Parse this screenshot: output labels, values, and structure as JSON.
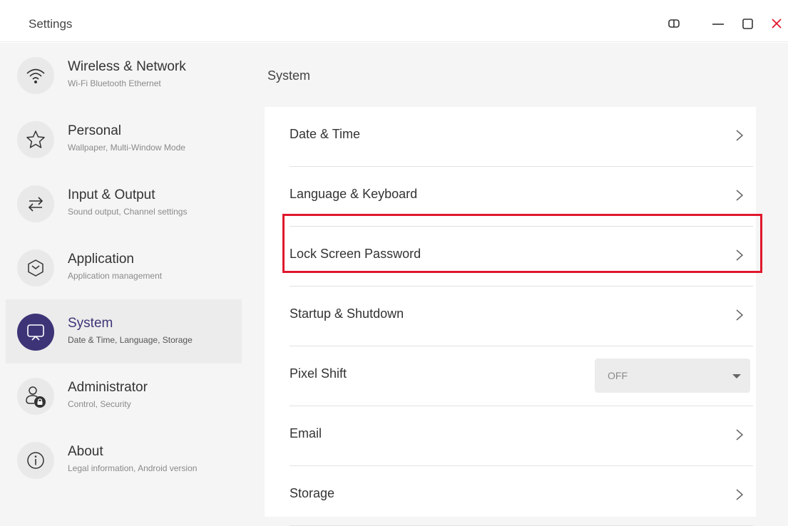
{
  "window": {
    "title": "Settings"
  },
  "sidebar": {
    "items": [
      {
        "title": "Wireless & Network",
        "subtitle": "Wi-Fi Bluetooth Ethernet",
        "icon": "wifi-icon"
      },
      {
        "title": "Personal",
        "subtitle": "Wallpaper, Multi-Window Mode",
        "icon": "star-icon"
      },
      {
        "title": "Input & Output",
        "subtitle": "Sound output, Channel settings",
        "icon": "swap-arrows-icon"
      },
      {
        "title": "Application",
        "subtitle": "Application management",
        "icon": "cube-icon"
      },
      {
        "title": "System",
        "subtitle": "Date & Time, Language, Storage",
        "icon": "monitor-icon",
        "active": true
      },
      {
        "title": "Administrator",
        "subtitle": "Control, Security",
        "icon": "user-lock-icon"
      },
      {
        "title": "About",
        "subtitle": "Legal information, Android version",
        "icon": "info-icon"
      }
    ]
  },
  "main": {
    "section_title": "System",
    "rows": [
      {
        "label": "Date & Time"
      },
      {
        "label": "Language & Keyboard"
      },
      {
        "label": "Lock Screen Password",
        "highlighted": true
      },
      {
        "label": "Startup & Shutdown"
      },
      {
        "label": "Pixel Shift",
        "dropdown_value": "OFF"
      },
      {
        "label": "Email"
      },
      {
        "label": "Storage"
      }
    ]
  },
  "colors": {
    "accent": "#3d3477",
    "highlight_border": "#e0182d",
    "close": "#e0182d"
  }
}
